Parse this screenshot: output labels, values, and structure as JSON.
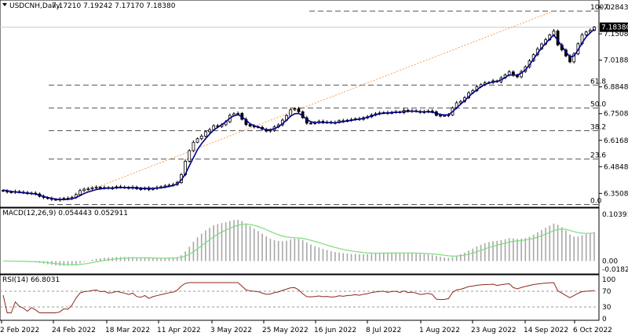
{
  "chart_data": {
    "type": "candlestick",
    "symbol_header": "USDCNH,Daily",
    "ohlc_header": "7.17210 7.19242 7.17170 7.18380",
    "current_price_label": "7.18380",
    "price_axis_labels": [
      "7.28430",
      "7.15080",
      "7.01880",
      "6.88480",
      "6.75080",
      "6.61680",
      "6.48480",
      "6.35080"
    ],
    "ylim": [
      6.305,
      7.285
    ],
    "fib_levels": [
      {
        "label": "100.0",
        "value": 7.265
      },
      {
        "label": "61.8",
        "value": 6.894
      },
      {
        "label": "50.0",
        "value": 6.779
      },
      {
        "label": "38.2",
        "value": 6.665
      },
      {
        "label": "23.6",
        "value": 6.523
      },
      {
        "label": "0.0",
        "value": 6.295
      }
    ],
    "date_labels": [
      "2 Feb 2022",
      "24 Feb 2022",
      "18 Mar 2022",
      "11 Apr 2022",
      "3 May 2022",
      "25 May 2022",
      "16 Jun 2022",
      "8 Jul 2022",
      "1 Aug 2022",
      "23 Aug 2022",
      "14 Sep 2022",
      "6 Oct 2022"
    ],
    "trend_line": {
      "from": {
        "date": "24 Feb 2022",
        "value": 6.31
      },
      "to": {
        "date": "27 Sep 2022",
        "value": 7.265
      }
    },
    "closes": [
      6.362,
      6.358,
      6.356,
      6.36,
      6.357,
      6.355,
      6.35,
      6.352,
      6.348,
      6.336,
      6.33,
      6.325,
      6.321,
      6.318,
      6.322,
      6.326,
      6.324,
      6.33,
      6.345,
      6.365,
      6.372,
      6.374,
      6.379,
      6.382,
      6.378,
      6.38,
      6.376,
      6.378,
      6.384,
      6.382,
      6.38,
      6.377,
      6.382,
      6.374,
      6.372,
      6.378,
      6.37,
      6.376,
      6.38,
      6.384,
      6.388,
      6.392,
      6.395,
      6.405,
      6.445,
      6.512,
      6.565,
      6.607,
      6.625,
      6.638,
      6.66,
      6.67,
      6.69,
      6.686,
      6.695,
      6.71,
      6.742,
      6.75,
      6.752,
      6.722,
      6.696,
      6.688,
      6.685,
      6.682,
      6.672,
      6.663,
      6.667,
      6.684,
      6.694,
      6.718,
      6.741,
      6.77,
      6.775,
      6.76,
      6.73,
      6.703,
      6.702,
      6.705,
      6.712,
      6.706,
      6.708,
      6.704,
      6.706,
      6.715,
      6.712,
      6.718,
      6.72,
      6.725,
      6.722,
      6.73,
      6.735,
      6.744,
      6.75,
      6.754,
      6.756,
      6.752,
      6.758,
      6.76,
      6.756,
      6.768,
      6.762,
      6.765,
      6.762,
      6.757,
      6.76,
      6.764,
      6.76,
      6.742,
      6.74,
      6.741,
      6.744,
      6.78,
      6.805,
      6.812,
      6.83,
      6.855,
      6.866,
      6.885,
      6.896,
      6.905,
      6.907,
      6.915,
      6.91,
      6.93,
      6.945,
      6.96,
      6.942,
      6.935,
      6.962,
      6.985,
      7.015,
      7.046,
      7.075,
      7.1,
      7.121,
      7.145,
      7.165,
      7.095,
      7.07,
      7.04,
      7.01,
      7.05,
      7.101,
      7.146,
      7.16,
      7.168,
      7.184
    ],
    "ma_values": [
      6.368,
      6.364,
      6.361,
      6.358,
      6.356,
      6.354,
      6.352,
      6.35,
      6.348,
      6.342,
      6.336,
      6.33,
      6.326,
      6.322,
      6.32,
      6.32,
      6.321,
      6.324,
      6.33,
      6.34,
      6.35,
      6.358,
      6.364,
      6.37,
      6.373,
      6.376,
      6.377,
      6.378,
      6.379,
      6.38,
      6.38,
      6.38,
      6.379,
      6.378,
      6.377,
      6.376,
      6.376,
      6.376,
      6.377,
      6.379,
      6.382,
      6.386,
      6.39,
      6.398,
      6.418,
      6.448,
      6.49,
      6.53,
      6.57,
      6.6,
      6.625,
      6.648,
      6.668,
      6.682,
      6.695,
      6.71,
      6.728,
      6.74,
      6.745,
      6.735,
      6.718,
      6.7,
      6.69,
      6.684,
      6.676,
      6.67,
      6.67,
      6.675,
      6.685,
      6.7,
      6.718,
      6.738,
      6.75,
      6.752,
      6.74,
      6.722,
      6.71,
      6.706,
      6.706,
      6.706,
      6.706,
      6.705,
      6.705,
      6.708,
      6.71,
      6.714,
      6.717,
      6.721,
      6.723,
      6.727,
      6.732,
      6.739,
      6.745,
      6.75,
      6.753,
      6.754,
      6.756,
      6.758,
      6.758,
      6.761,
      6.762,
      6.763,
      6.762,
      6.76,
      6.76,
      6.76,
      6.758,
      6.752,
      6.746,
      6.744,
      6.745,
      6.76,
      6.78,
      6.798,
      6.816,
      6.836,
      6.854,
      6.87,
      6.885,
      6.897,
      6.904,
      6.91,
      6.912,
      6.92,
      6.932,
      6.945,
      6.944,
      6.944,
      6.954,
      6.97,
      6.995,
      7.024,
      7.053,
      7.08,
      7.103,
      7.125,
      7.145,
      7.118,
      7.09,
      7.06,
      7.035,
      7.04,
      7.07,
      7.105,
      7.135,
      7.156,
      7.174
    ],
    "macd": {
      "label": "MACD(12,26,9) 0.054443 0.052911",
      "axis_labels": [
        "0.103913",
        "0.00",
        "-0.018273"
      ],
      "ylim": [
        -0.018273,
        0.103913
      ]
    },
    "rsi": {
      "label": "RSI(14) 66.8031",
      "axis_labels": [
        "100",
        "70",
        "30",
        "0"
      ],
      "levels": [
        70,
        30
      ],
      "ylim": [
        0,
        100
      ]
    },
    "colors": {
      "ma": "#00008b",
      "signal": "#7ddc7d",
      "rsi": "#8b2a1a",
      "trend": "#ff9d4d",
      "fib": "#555555"
    }
  }
}
